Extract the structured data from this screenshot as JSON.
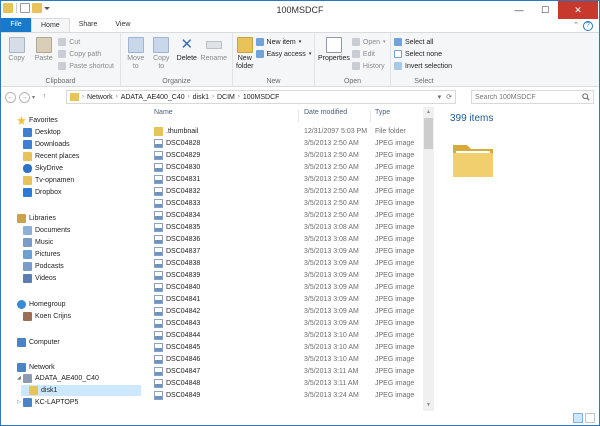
{
  "window": {
    "title": "100MSDCF"
  },
  "titlebar": {
    "min_glyph": "—",
    "max_glyph": "☐",
    "close_glyph": "✕"
  },
  "tabs": [
    {
      "label": "File"
    },
    {
      "label": "Home"
    },
    {
      "label": "Share"
    },
    {
      "label": "View"
    }
  ],
  "ribbon": {
    "help_glyph": "?",
    "collapse_glyph": "⌃",
    "clipboard": {
      "label": "Clipboard",
      "copy": "Copy",
      "paste": "Paste",
      "cut": "Cut",
      "copy_path": "Copy path",
      "paste_shortcut": "Paste shortcut"
    },
    "organize": {
      "label": "Organize",
      "move_to": "Move to",
      "copy_to": "Copy to",
      "delete": "Delete",
      "rename": "Rename"
    },
    "new": {
      "label": "New",
      "new_folder": "New folder",
      "new_item": "New item",
      "easy_access": "Easy access"
    },
    "open": {
      "label": "Open",
      "properties": "Properties",
      "open": "Open",
      "edit": "Edit",
      "history": "History"
    },
    "select": {
      "label": "Select",
      "select_all": "Select all",
      "select_none": "Select none",
      "invert_selection": "Invert selection"
    }
  },
  "address": {
    "back_glyph": "←",
    "forward_glyph": "→",
    "up_glyph": "↑",
    "crumbs": [
      "Network",
      "ADATA_AE400_C40",
      "disk1",
      "DCIM",
      "100MSDCF"
    ],
    "crumb_sep": "›",
    "dropdown_glyph": "▾",
    "refresh_glyph": "⟳"
  },
  "search": {
    "placeholder": "Search 100MSDCF"
  },
  "nav": {
    "favorites": "Favorites",
    "favorites_items": [
      "Desktop",
      "Downloads",
      "Recent places",
      "SkyDrive",
      "Tv-opnamen",
      "Dropbox"
    ],
    "libraries": "Libraries",
    "libraries_items": [
      "Documents",
      "Music",
      "Pictures",
      "Podcasts",
      "Videos"
    ],
    "homegroup": "Homegroup",
    "homegroup_items": [
      "Koen Crijns"
    ],
    "computer": "Computer",
    "network": "Network",
    "network_items": [
      "ADATA_AE400_C40",
      "disk1",
      "KC-LAPTOP5"
    ]
  },
  "columns": {
    "name": "Name",
    "date": "Date modified",
    "type": "Type"
  },
  "files": [
    {
      "name": ".thumbnail",
      "date": "12/31/2097 5:03 PM",
      "type": "File folder",
      "kind": "folder"
    },
    {
      "name": "DSC04828",
      "date": "3/5/2013 2:50 AM",
      "type": "JPEG image",
      "kind": "image"
    },
    {
      "name": "DSC04829",
      "date": "3/5/2013 2:50 AM",
      "type": "JPEG image",
      "kind": "image"
    },
    {
      "name": "DSC04830",
      "date": "3/5/2013 2:50 AM",
      "type": "JPEG image",
      "kind": "image"
    },
    {
      "name": "DSC04831",
      "date": "3/5/2013 2:50 AM",
      "type": "JPEG image",
      "kind": "image"
    },
    {
      "name": "DSC04832",
      "date": "3/5/2013 2:50 AM",
      "type": "JPEG image",
      "kind": "image"
    },
    {
      "name": "DSC04833",
      "date": "3/5/2013 2:50 AM",
      "type": "JPEG image",
      "kind": "image"
    },
    {
      "name": "DSC04834",
      "date": "3/5/2013 2:50 AM",
      "type": "JPEG image",
      "kind": "image"
    },
    {
      "name": "DSC04835",
      "date": "3/5/2013 3:08 AM",
      "type": "JPEG image",
      "kind": "image"
    },
    {
      "name": "DSC04836",
      "date": "3/5/2013 3:08 AM",
      "type": "JPEG image",
      "kind": "image"
    },
    {
      "name": "DSC04837",
      "date": "3/5/2013 3:09 AM",
      "type": "JPEG image",
      "kind": "image"
    },
    {
      "name": "DSC04838",
      "date": "3/5/2013 3:09 AM",
      "type": "JPEG image",
      "kind": "image"
    },
    {
      "name": "DSC04839",
      "date": "3/5/2013 3:09 AM",
      "type": "JPEG image",
      "kind": "image"
    },
    {
      "name": "DSC04840",
      "date": "3/5/2013 3:09 AM",
      "type": "JPEG image",
      "kind": "image"
    },
    {
      "name": "DSC04841",
      "date": "3/5/2013 3:09 AM",
      "type": "JPEG image",
      "kind": "image"
    },
    {
      "name": "DSC04842",
      "date": "3/5/2013 3:09 AM",
      "type": "JPEG image",
      "kind": "image"
    },
    {
      "name": "DSC04843",
      "date": "3/5/2013 3:09 AM",
      "type": "JPEG image",
      "kind": "image"
    },
    {
      "name": "DSC04844",
      "date": "3/5/2013 3:10 AM",
      "type": "JPEG image",
      "kind": "image"
    },
    {
      "name": "DSC04845",
      "date": "3/5/2013 3:10 AM",
      "type": "JPEG image",
      "kind": "image"
    },
    {
      "name": "DSC04846",
      "date": "3/5/2013 3:10 AM",
      "type": "JPEG image",
      "kind": "image"
    },
    {
      "name": "DSC04847",
      "date": "3/5/2013 3:11 AM",
      "type": "JPEG image",
      "kind": "image"
    },
    {
      "name": "DSC04848",
      "date": "3/5/2013 3:11 AM",
      "type": "JPEG image",
      "kind": "image"
    },
    {
      "name": "DSC04849",
      "date": "3/5/2013 3:24 AM",
      "type": "JPEG image",
      "kind": "image"
    }
  ],
  "details": {
    "count": "399 items"
  },
  "colors": {
    "accent": "#1979ca",
    "folder": "#e8c35a",
    "selection": "#cce8ff",
    "close": "#c7392c"
  }
}
